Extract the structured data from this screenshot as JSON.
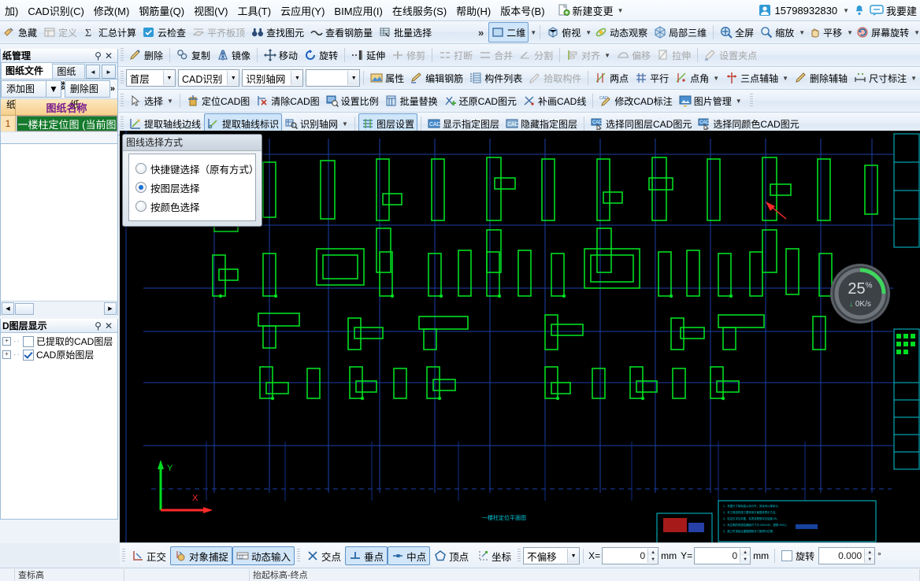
{
  "menubar": {
    "items": [
      {
        "label": "加)"
      },
      {
        "label": "CAD识别(C)"
      },
      {
        "label": "修改(M)"
      },
      {
        "label": "钢筋量(Q)"
      },
      {
        "label": "视图(V)"
      },
      {
        "label": "工具(T)"
      },
      {
        "label": "云应用(Y)"
      },
      {
        "label": "BIM应用(I)"
      },
      {
        "label": "在线服务(S)"
      },
      {
        "label": "帮助(H)"
      },
      {
        "label": "版本号(B)"
      }
    ],
    "new_change": "新建变更",
    "account": "15798932830",
    "feedback": "我要建"
  },
  "toolbar1": {
    "items": [
      {
        "label": "急藏",
        "icon": "hide-icon",
        "disabled": false
      },
      {
        "label": "定义",
        "icon": "define-icon",
        "disabled": true
      },
      {
        "label": "汇总计算",
        "icon": "sigma-icon",
        "disabled": false
      },
      {
        "label": "云检查",
        "icon": "cloud-check-icon",
        "disabled": false
      },
      {
        "label": "平齐板顶",
        "icon": "align-slab-icon",
        "disabled": true
      },
      {
        "label": "查找图元",
        "icon": "binoculars-icon",
        "disabled": false
      },
      {
        "label": "查看钢筋量",
        "icon": "view-rebar-icon",
        "disabled": false
      },
      {
        "label": "批量选择",
        "icon": "batch-select-icon",
        "disabled": false
      }
    ],
    "overflow": "»",
    "right_items": [
      {
        "label": "二维",
        "icon": "cube-2d-icon",
        "dropdown": true
      },
      {
        "label": "俯视",
        "icon": "top-view-icon",
        "dropdown": true
      },
      {
        "label": "动态观察",
        "icon": "orbit-icon",
        "dropdown": false
      },
      {
        "label": "局部三维",
        "icon": "local-3d-icon",
        "dropdown": false
      },
      {
        "label": "全屏",
        "icon": "fullscreen-icon",
        "dropdown": false
      },
      {
        "label": "缩放",
        "icon": "zoom-icon",
        "dropdown": true
      },
      {
        "label": "平移",
        "icon": "pan-icon",
        "dropdown": true
      },
      {
        "label": "屏幕旋转",
        "icon": "screen-rotate-icon",
        "dropdown": true
      }
    ]
  },
  "toolbar2": {
    "items": [
      {
        "label": "删除",
        "icon": "delete-icon",
        "disabled": false
      },
      {
        "label": "复制",
        "icon": "copy-icon",
        "disabled": false
      },
      {
        "label": "镜像",
        "icon": "mirror-icon",
        "disabled": false
      },
      {
        "label": "移动",
        "icon": "move-icon",
        "disabled": false
      },
      {
        "label": "旋转",
        "icon": "rotate-icon",
        "disabled": false
      },
      {
        "label": "延伸",
        "icon": "extend-icon",
        "disabled": false
      },
      {
        "label": "修剪",
        "icon": "trim-icon",
        "disabled": true
      },
      {
        "label": "打断",
        "icon": "break-icon",
        "disabled": true
      },
      {
        "label": "合并",
        "icon": "merge-icon",
        "disabled": true
      },
      {
        "label": "分割",
        "icon": "split-icon",
        "disabled": true
      },
      {
        "label": "对齐",
        "icon": "align-icon",
        "disabled": true,
        "dropdown": true
      },
      {
        "label": "偏移",
        "icon": "offset-icon",
        "disabled": true
      },
      {
        "label": "拉伸",
        "icon": "stretch-icon",
        "disabled": true
      },
      {
        "label": "设置夹点",
        "icon": "set-grip-icon",
        "disabled": true
      }
    ]
  },
  "toolbar3": {
    "floor_select": "首层",
    "module_select": "CAD识别",
    "func_select": "识别轴网",
    "empty_select": "",
    "items": [
      {
        "label": "属性",
        "icon": "properties-icon",
        "disabled": false
      },
      {
        "label": "编辑钢筋",
        "icon": "edit-rebar-icon",
        "disabled": false
      },
      {
        "label": "构件列表",
        "icon": "component-list-icon",
        "disabled": false
      },
      {
        "label": "拾取构件",
        "icon": "pick-component-icon",
        "disabled": true
      },
      {
        "label": "两点",
        "icon": "two-point-icon",
        "disabled": false
      },
      {
        "label": "平行",
        "icon": "parallel-icon",
        "disabled": false
      },
      {
        "label": "点角",
        "icon": "point-angle-icon",
        "disabled": false,
        "dropdown": true
      },
      {
        "label": "三点辅轴",
        "icon": "three-point-axis-icon",
        "disabled": false,
        "dropdown": true
      },
      {
        "label": "删除辅轴",
        "icon": "delete-aux-axis-icon",
        "disabled": false
      },
      {
        "label": "尺寸标注",
        "icon": "dimension-icon",
        "disabled": false,
        "dropdown": true
      }
    ]
  },
  "toolbar4": {
    "items": [
      {
        "label": "选择",
        "icon": "cursor-select-icon",
        "dropdown": true
      },
      {
        "label": "定位CAD图",
        "icon": "locate-cad-icon",
        "dropdown": false
      },
      {
        "label": "清除CAD图",
        "icon": "clear-cad-icon",
        "dropdown": false
      },
      {
        "label": "设置比例",
        "icon": "set-scale-icon",
        "dropdown": false
      },
      {
        "label": "批量替换",
        "icon": "batch-replace-icon",
        "dropdown": false
      },
      {
        "label": "还原CAD图元",
        "icon": "restore-cad-icon",
        "dropdown": false
      },
      {
        "label": "补画CAD线",
        "icon": "draw-cad-line-icon",
        "dropdown": false
      },
      {
        "label": "修改CAD标注",
        "icon": "modify-cad-dim-icon",
        "dropdown": false
      },
      {
        "label": "图片管理",
        "icon": "image-manager-icon",
        "dropdown": true
      }
    ]
  },
  "toolbar5": {
    "items": [
      {
        "label": "提取轴线边线",
        "icon": "extract-axis-edge-icon",
        "selected": false
      },
      {
        "label": "提取轴线标识",
        "icon": "extract-axis-label-icon",
        "selected": true
      },
      {
        "label": "识别轴网",
        "icon": "recognize-axis-icon",
        "selected": false,
        "dropdown": true
      },
      {
        "label": "图层设置",
        "icon": "layer-settings-icon",
        "selected": true
      },
      {
        "label": "显示指定图层",
        "icon": "show-layer-icon",
        "selected": false
      },
      {
        "label": "隐藏指定图层",
        "icon": "hide-layer-icon",
        "selected": false
      },
      {
        "label": "选择同图层CAD图元",
        "icon": "select-same-layer-icon",
        "selected": false
      },
      {
        "label": "选择同颜色CAD图元",
        "icon": "select-same-color-icon",
        "selected": false
      }
    ]
  },
  "drawing_panel": {
    "title": "纸管理",
    "pin": "pin-icon",
    "close": "close-icon",
    "tabs": [
      {
        "label": "图纸文件列表",
        "active": true
      },
      {
        "label": "图纸楼]",
        "active": false
      }
    ],
    "nav_prev": "◄",
    "nav_next": "►",
    "buttons": [
      {
        "label": "添加图纸",
        "dropdown": true
      },
      {
        "label": "删除图纸",
        "dropdown": false
      }
    ],
    "overflow": "»",
    "columns": [
      "",
      "图纸名称"
    ],
    "rows": [
      {
        "index": "1",
        "name": "一楼柱定位图 (当前图"
      }
    ]
  },
  "layer_panel": {
    "title": "D图层显示",
    "pin": "pin-icon",
    "close": "close-icon",
    "nodes": [
      {
        "label": "已提取的CAD图层",
        "checked": false,
        "expander": "+"
      },
      {
        "label": "CAD原始图层",
        "checked": true,
        "expander": "+"
      }
    ]
  },
  "dialog": {
    "title": "图线选择方式",
    "options": [
      {
        "label": "快捷键选择（原有方式）",
        "selected": false
      },
      {
        "label": "按图层选择",
        "selected": true
      },
      {
        "label": "按颜色选择",
        "selected": false
      }
    ]
  },
  "progress": {
    "percent": "25",
    "percent_symbol": "%",
    "speed": "0K/s",
    "arrow": "↓",
    "value": 25,
    "accent": "#3fd65e"
  },
  "statusbar": {
    "toggles": [
      {
        "label": "正交",
        "icon": "ortho-icon",
        "on": false
      },
      {
        "label": "对象捕捉",
        "icon": "osnap-icon",
        "on": true
      },
      {
        "label": "动态输入",
        "icon": "dyninput-icon",
        "on": true
      },
      {
        "label": "交点",
        "icon": "intersection-icon",
        "on": false
      },
      {
        "label": "垂点",
        "icon": "perpendicular-icon",
        "on": true
      },
      {
        "label": "中点",
        "icon": "midpoint-icon",
        "on": true
      },
      {
        "label": "顶点",
        "icon": "vertex-icon",
        "on": false
      },
      {
        "label": "坐标",
        "icon": "coordinate-icon",
        "on": false
      }
    ],
    "offset_mode": "不偏移",
    "x_label": "X=",
    "x_value": "0",
    "x_unit": "mm",
    "y_label": "Y=",
    "y_value": "0",
    "y_unit": "mm",
    "rotate_checked": false,
    "rotate_label": "旋转",
    "rotate_value": "0.000",
    "rotate_unit": "°"
  },
  "footer": {
    "cells": [
      "",
      "查标高",
      "",
      "抬起标高-终点"
    ]
  },
  "canvas": {
    "axis_x_label": "X",
    "axis_y_label": "Y",
    "caption": "一楼柱定位平面图",
    "background": "#000000",
    "wall_color": "#00dd22",
    "axis_color": "#1b4fd0",
    "cyan": "#00c8d8"
  }
}
